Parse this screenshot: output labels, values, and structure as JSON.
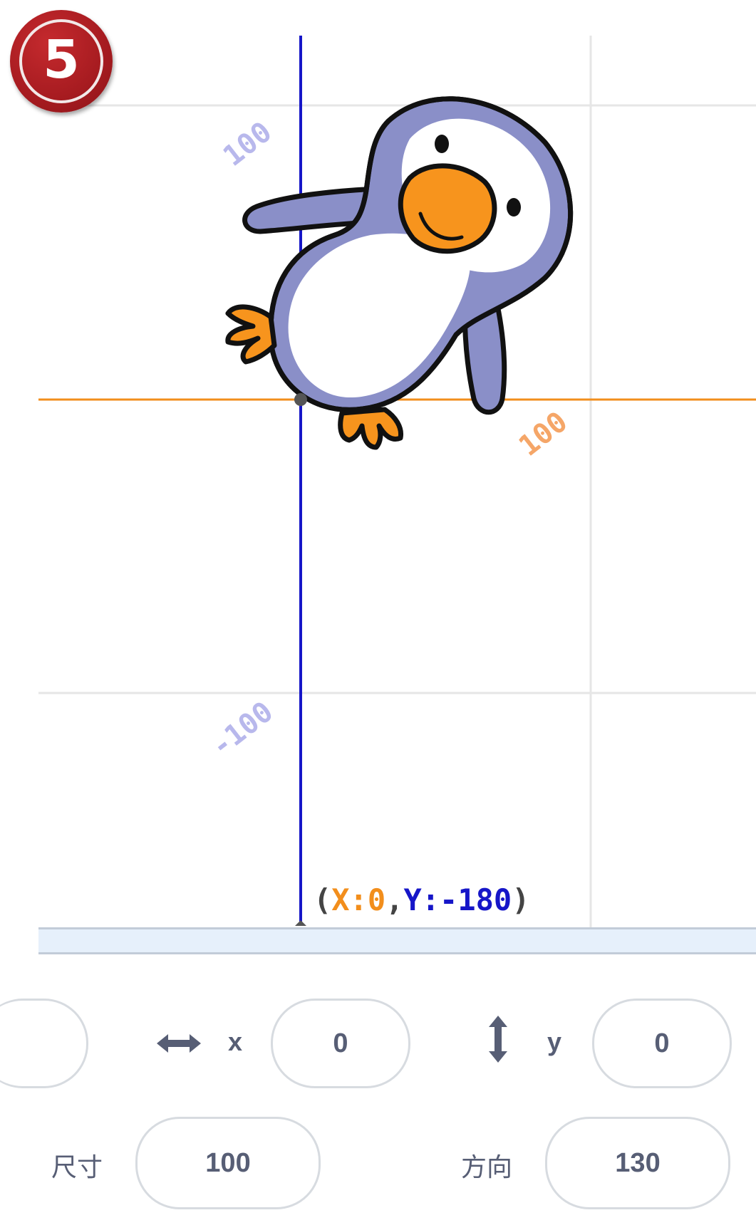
{
  "step_badge": {
    "number": "5"
  },
  "stage": {
    "grid_labels": {
      "y_pos_100": "100",
      "x_pos_100": "100",
      "y_neg_100": "-100"
    },
    "coordinate_readout": {
      "open": "(",
      "x_label": "X:",
      "x_value": "0",
      "separator": ",",
      "y_label": "Y:",
      "y_value": "-180",
      "close": ")"
    },
    "colors": {
      "x_axis": "#f28e1c",
      "y_axis": "#1616c8",
      "grid": "#e6e6e6",
      "x_label": "#f5a668",
      "y_label": "#b8b8ec"
    }
  },
  "sprite_info": {
    "x_icon": "horizontal-arrows-icon",
    "x_label": "x",
    "x_value": "0",
    "y_icon": "vertical-arrows-icon",
    "y_label": "y",
    "y_value": "0",
    "size_label": "尺寸",
    "size_value": "100",
    "direction_label": "方向",
    "direction_value": "130"
  }
}
